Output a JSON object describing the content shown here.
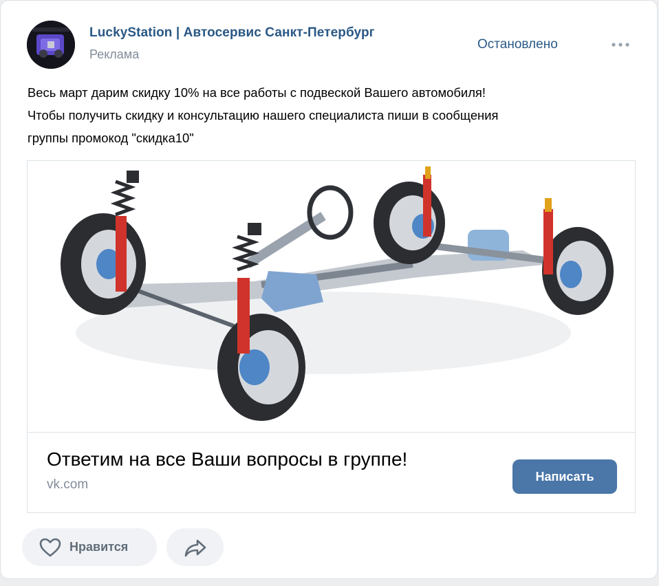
{
  "post": {
    "group_name": "LuckyStation | Автосервис Санкт-Петербург",
    "ad_label": "Реклама",
    "status": "Остановлено",
    "text_lines": [
      "Весь март дарим скидку 10% на все работы с подвеской Вашего автомобиля!",
      "Чтобы получить скидку и консультацию нашего специалиста пиши в сообщения",
      "группы промокод \"скидка10\""
    ]
  },
  "ad": {
    "image_icon": "car-suspension-illustration",
    "headline": "Ответим на все Ваши вопросы в группе!",
    "domain": "vk.com",
    "button_label": "Написать"
  },
  "actions": {
    "like_label": "Нравится",
    "like_icon": "heart-icon",
    "share_icon": "share-arrow-icon"
  },
  "colors": {
    "link": "#2a5885",
    "button": "#4a76a8",
    "secondary_text": "#818c99",
    "action_bg": "#f0f2f5"
  }
}
